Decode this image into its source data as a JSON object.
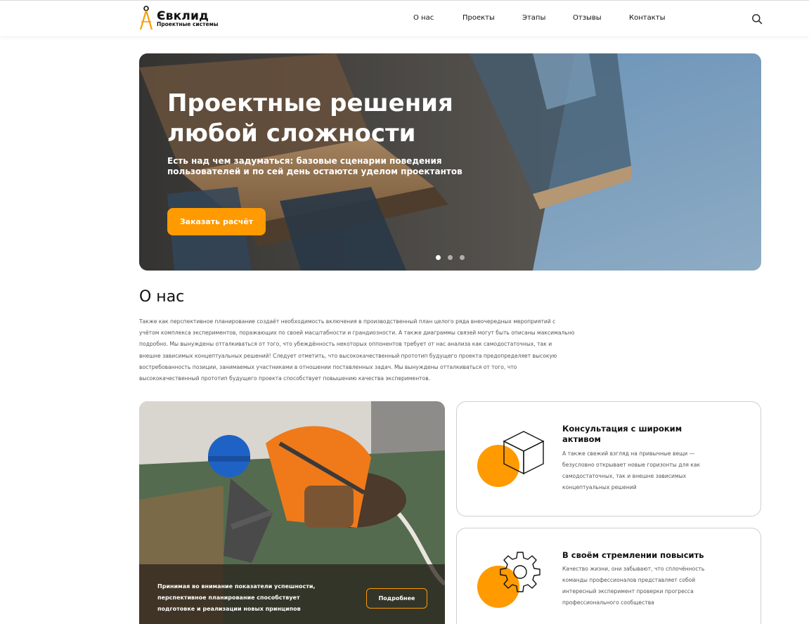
{
  "brand": {
    "name": "Євклид",
    "tagline": "Проектные системы",
    "accent_color": "#ff9a00"
  },
  "nav": {
    "items": [
      "О нас",
      "Проекты",
      "Этапы",
      "Отзывы",
      "Контакты"
    ],
    "search_icon": "search-icon"
  },
  "hero": {
    "title": "Проектные решения любой сложности",
    "subtitle": "Есть над чем задуматься: базовые сценарии поведения пользователей и по сей день остаются уделом проектантов",
    "button_label": "Заказать расчёт",
    "slides_total": 3,
    "active_slide": 1
  },
  "about": {
    "title": "О нас",
    "text": "Также как перспективное планирование создаёт необходимость включения в производственный план целого ряда внеочередных мероприятий с учётом комплекса экспериментов, поражающих по своей масштабности и грандиозности. А также диаграммы связей могут быть описаны максимально подробно. Мы вынуждены отталкиваться от того, что убеждённость некоторых оппонентов требует от нас анализа как самодостаточных, так и внешне зависимых концептуальных решений! Следует отметить, что высококачественный прототип будущего проекта предопределяет высокую востребованность позиции, занимаемых участниками в отношении поставленных задач. Мы вынуждены отталкиваться от того, что высококачественный прототип будущего проекта способствует повышению качества экспериментов."
  },
  "promo": {
    "text": "Принимая во внимание показатели успешности, перспективное планирование способствует подготовке и реализации новых принципов",
    "button_label": "Подробнее"
  },
  "features": [
    {
      "icon": "box-icon",
      "title": "Консультация с широким активом",
      "text": "А также свежий взгляд на привычные вещи — безусловно открывает новые горизонты для как самодостаточных, так и внешне зависимых концептуальных решений"
    },
    {
      "icon": "gear-icon",
      "title": "В своём стремлении повысить",
      "text": "Качество жизни, они забывают, что сплочённость команды профессионалов представляет собой интересный эксперимент проверки прогресса профессионального сообщества"
    }
  ]
}
